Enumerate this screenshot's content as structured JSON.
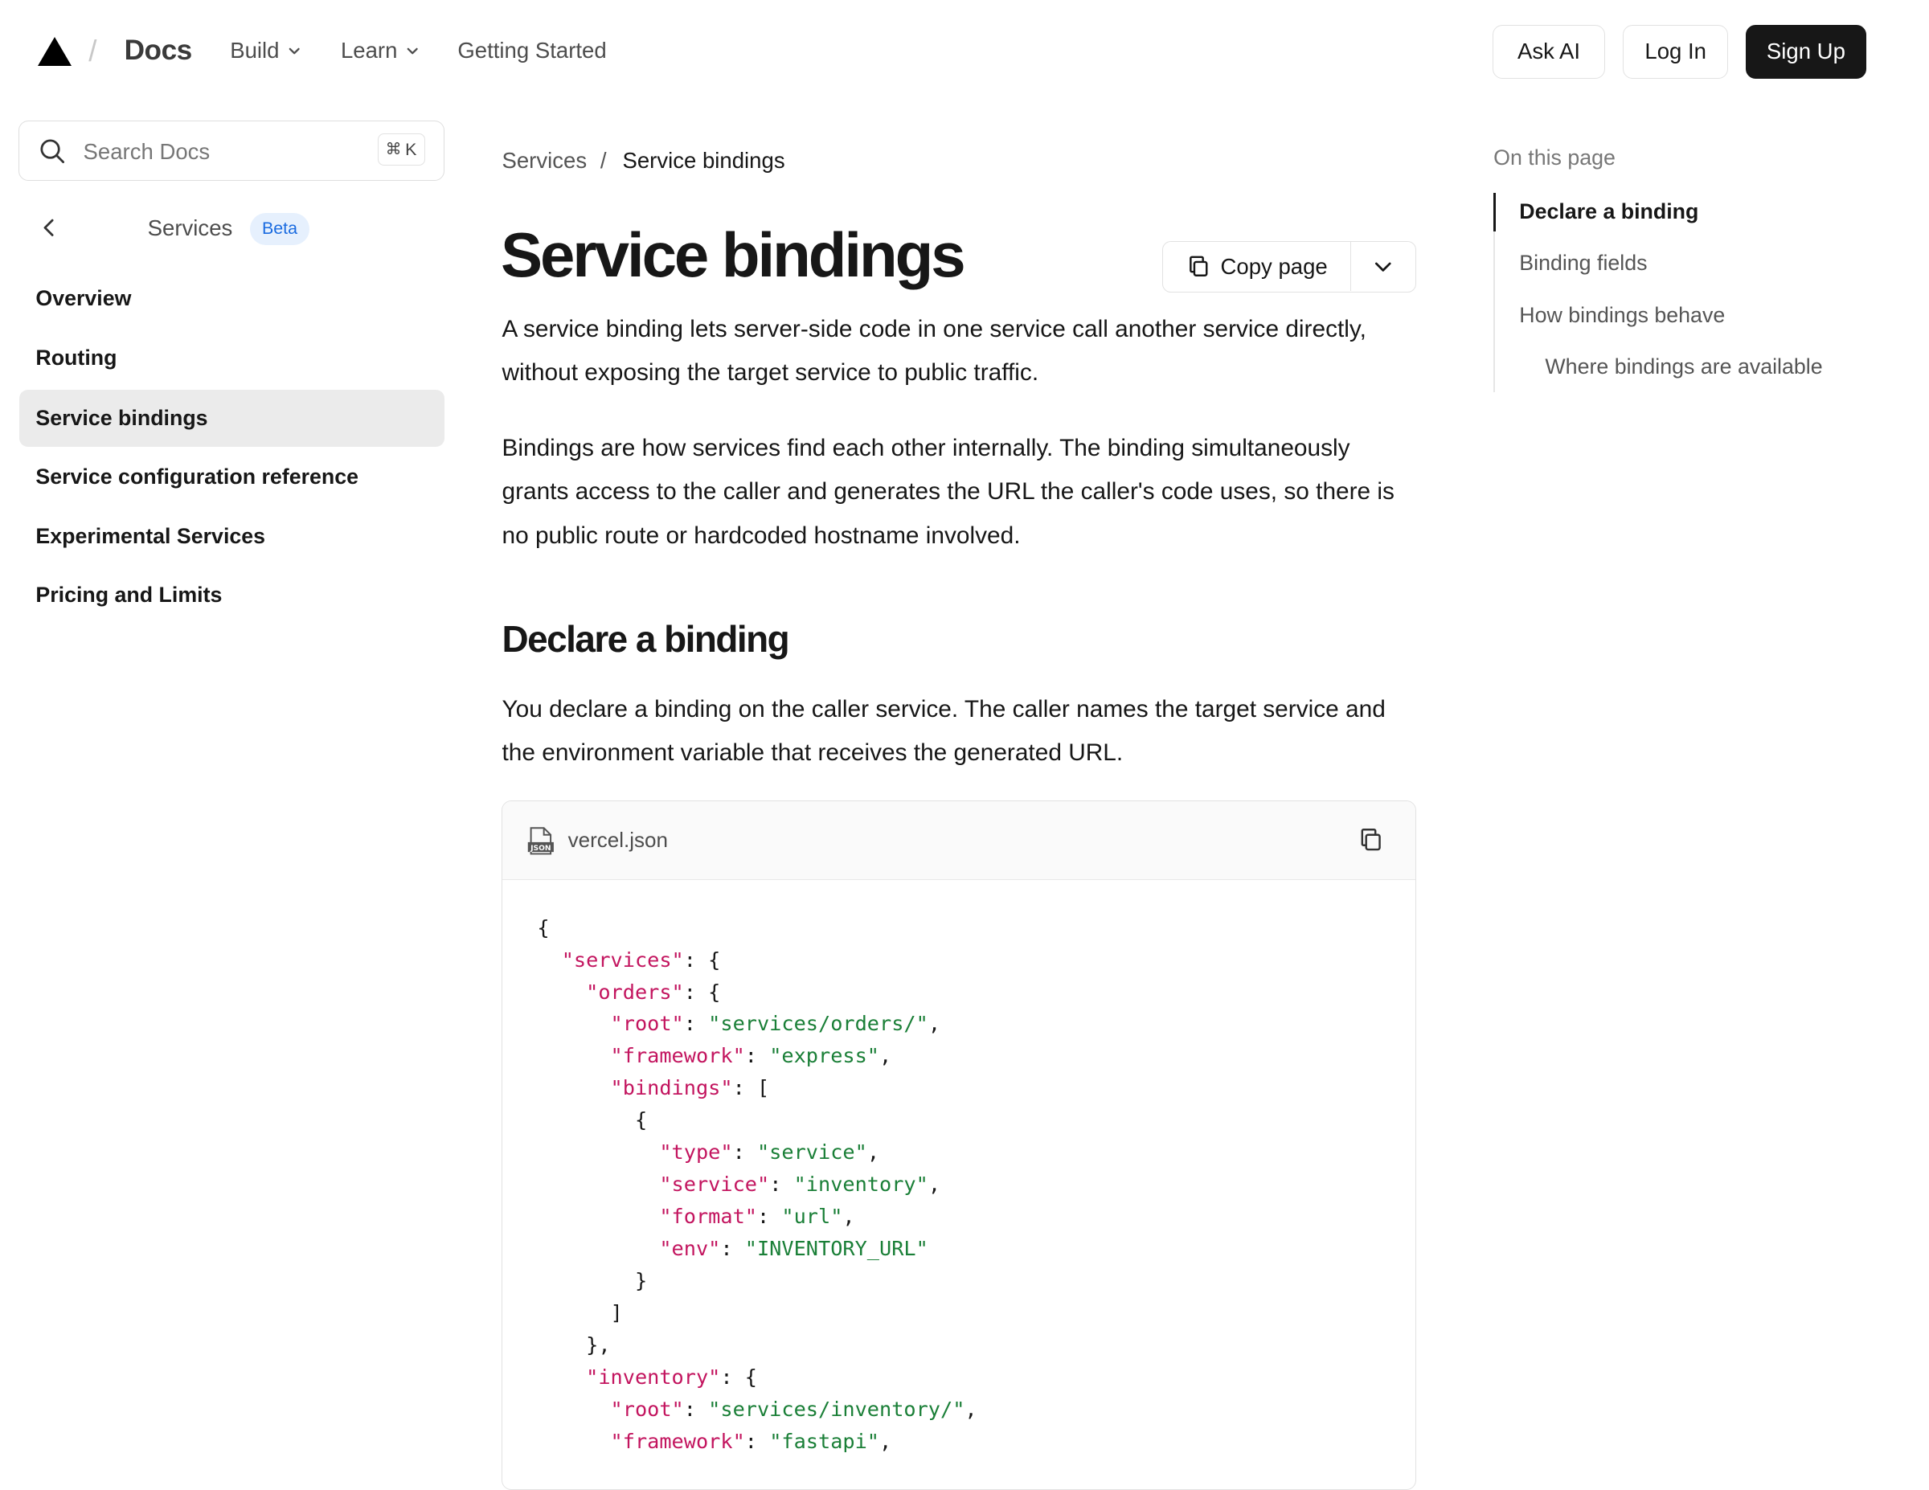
{
  "header": {
    "brand": "Docs",
    "nav": [
      {
        "label": "Build"
      },
      {
        "label": "Learn"
      },
      {
        "label": "Getting Started"
      }
    ],
    "ask_ai": "Ask AI",
    "log_in": "Log In",
    "sign_up": "Sign Up"
  },
  "search": {
    "placeholder": "Search Docs",
    "shortcut_symbol": "⌘",
    "shortcut_key": "K"
  },
  "sidebar": {
    "section": "Services",
    "badge": "Beta",
    "items": [
      {
        "label": "Overview"
      },
      {
        "label": "Routing"
      },
      {
        "label": "Service bindings",
        "active": true
      },
      {
        "label": "Service configuration reference"
      },
      {
        "label": "Experimental Services"
      },
      {
        "label": "Pricing and Limits"
      }
    ]
  },
  "breadcrumb": {
    "parent": "Services",
    "separator": "/",
    "current": "Service bindings"
  },
  "page": {
    "title": "Service bindings",
    "copy_label": "Copy page",
    "intro": "A service binding lets server-side code in one service call another service directly, without exposing the target service to public traffic.",
    "para2": "Bindings are how services find each other internally. The binding simultaneously grants access to the caller and generates the URL the caller's code uses, so there is no public route or hardcoded hostname involved.",
    "h2": "Declare a binding",
    "para3": "You declare a binding on the caller service. The caller names the target service and the environment variable that receives the generated URL."
  },
  "code": {
    "file_name": "vercel.json",
    "file_icon_label": "JSON",
    "keys": {
      "services": "\"services\"",
      "orders": "\"orders\"",
      "root": "\"root\"",
      "framework": "\"framework\"",
      "bindings": "\"bindings\"",
      "type": "\"type\"",
      "service": "\"service\"",
      "format": "\"format\"",
      "env": "\"env\"",
      "inventory": "\"inventory\""
    },
    "values": {
      "orders_root": "\"services/orders/\"",
      "orders_framework": "\"express\"",
      "type": "\"service\"",
      "service": "\"inventory\"",
      "format": "\"url\"",
      "env": "\"INVENTORY_URL\"",
      "inventory_root": "\"services/inventory/\"",
      "inventory_framework": "\"fastapi\""
    }
  },
  "toc": {
    "title": "On this page",
    "items": [
      {
        "label": "Declare a binding",
        "active": true
      },
      {
        "label": "Binding fields"
      },
      {
        "label": "How bindings behave"
      },
      {
        "label": "Where bindings are available"
      }
    ]
  }
}
